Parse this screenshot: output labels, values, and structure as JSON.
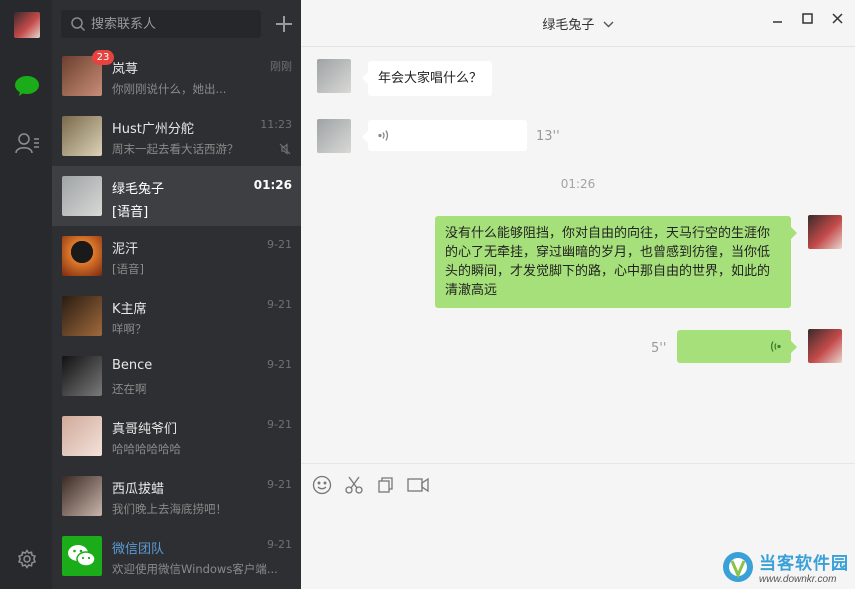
{
  "search": {
    "placeholder": "搜索联系人"
  },
  "contacts": [
    {
      "name": "岚荨",
      "preview": "你刚刚说什么，她出...",
      "time": "刚刚",
      "badge": "23",
      "active": false,
      "colors": [
        "#6b3f2e",
        "#c98e78"
      ]
    },
    {
      "name": "Hust广州分舵",
      "preview": "周末一起去看大话西游？",
      "time": "11:23",
      "badge": "",
      "muted": true,
      "active": false,
      "colors": [
        "#7a6a4a",
        "#dcd2b8"
      ]
    },
    {
      "name": "绿毛兔子",
      "preview": "[语音]",
      "time": "01:26",
      "badge": "",
      "active": true,
      "colors": [
        "#9ea3a5",
        "#d9d9d6"
      ]
    },
    {
      "name": "泥汗",
      "preview": "[语音]",
      "time": "9-21",
      "badge": "",
      "active": false,
      "colors": [
        "#1a1a1a",
        "#e07a2c"
      ]
    },
    {
      "name": "K主席",
      "preview": "咩啊？",
      "time": "9-21",
      "badge": "",
      "active": false,
      "colors": [
        "#2a1c12",
        "#a06a3c"
      ]
    },
    {
      "name": "Bence",
      "preview": "还在啊",
      "time": "9-21",
      "badge": "",
      "active": false,
      "colors": [
        "#111111",
        "#7a7a7a"
      ]
    },
    {
      "name": "真哥纯爷们",
      "preview": "哈哈哈哈哈哈",
      "time": "9-21",
      "badge": "",
      "active": false,
      "colors": [
        "#d0a99a",
        "#f4e2da"
      ]
    },
    {
      "name": "西瓜拔蜡",
      "preview": "我们晚上去海底捞吧！",
      "time": "9-21",
      "badge": "",
      "active": false,
      "colors": [
        "#3a2a24",
        "#c9b5aa"
      ]
    },
    {
      "name": "微信团队",
      "preview": "欢迎使用微信Windows客户端...",
      "time": "9-21",
      "badge": "",
      "active": false,
      "wx": true,
      "colors": [
        "#1aad19",
        "#1aad19"
      ]
    }
  ],
  "chat": {
    "title": "绿毛兔子",
    "messages": {
      "m1": "年会大家唱什么？",
      "m2_duration": "13''",
      "time_sep": "01:26",
      "m3": "没有什么能够阻挡，你对自由的向往，天马行空的生涯你的心了无牵挂，穿过幽暗的岁月，也曾感到彷徨，当你低头的瞬间，才发觉脚下的路，心中那自由的世界，如此的清澈高远",
      "m4_duration": "5''"
    }
  },
  "colors": {
    "accent_green": "#a6e07a",
    "badge_red": "#e64340",
    "wechat_green": "#1aad19",
    "link_blue": "#5b9bd5"
  },
  "watermark": {
    "cn": "当客软件园",
    "url": "www.downkr.com"
  }
}
